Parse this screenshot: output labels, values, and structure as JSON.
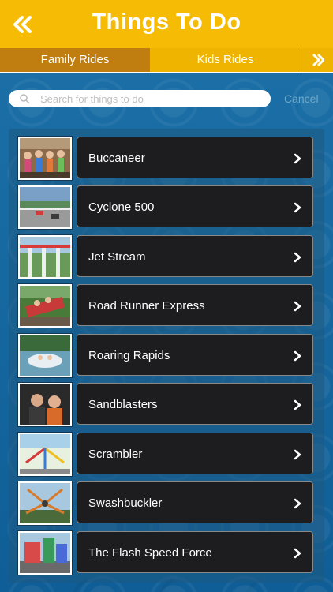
{
  "header": {
    "title": "Things To Do"
  },
  "tabs": [
    {
      "label": "Family Rides"
    },
    {
      "label": "Kids Rides"
    }
  ],
  "search": {
    "placeholder": "Search for things to do",
    "cancel_label": "Cancel"
  },
  "items": [
    {
      "label": "Buccaneer"
    },
    {
      "label": "Cyclone 500"
    },
    {
      "label": "Jet Stream"
    },
    {
      "label": "Road Runner Express"
    },
    {
      "label": "Roaring Rapids"
    },
    {
      "label": "Sandblasters"
    },
    {
      "label": "Scrambler"
    },
    {
      "label": "Swashbuckler"
    },
    {
      "label": "The Flash Speed Force"
    }
  ],
  "colors": {
    "header": "#f6bb05",
    "tab_active": "#c07d10",
    "background": "#1f73a8",
    "card": "#1d1d1f"
  }
}
